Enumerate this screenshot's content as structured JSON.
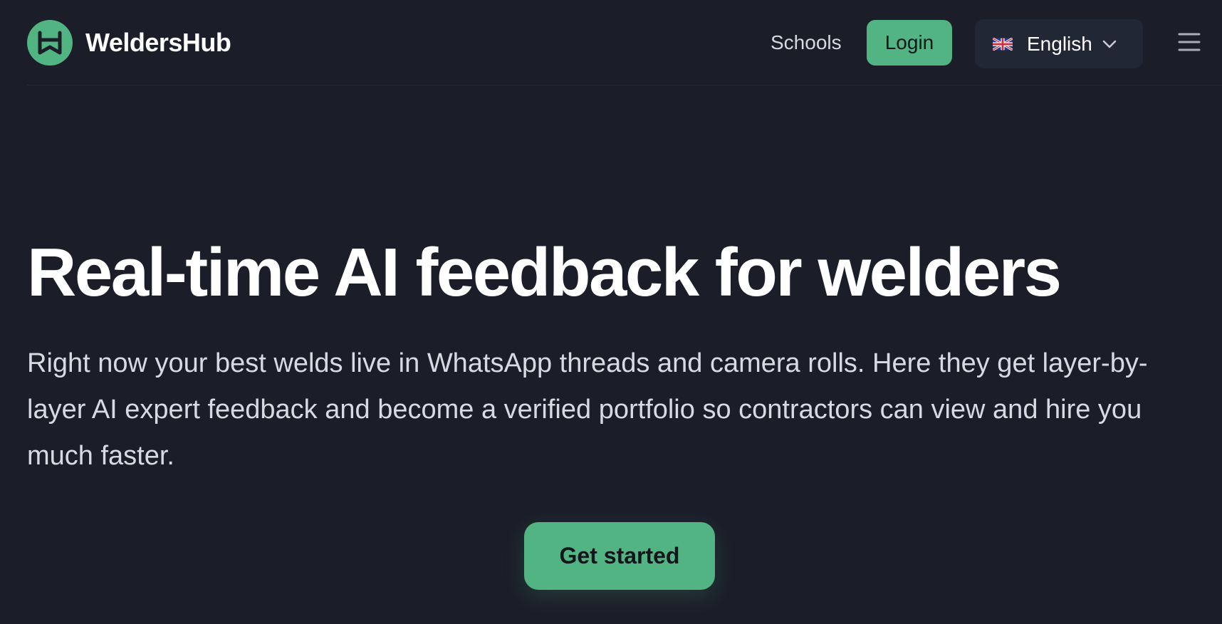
{
  "header": {
    "brand_name": "WeldersHub",
    "nav_schools": "Schools",
    "login_label": "Login",
    "language": {
      "selected": "English",
      "flag": "uk-flag-icon"
    },
    "menu_icon": "hamburger-menu-icon"
  },
  "hero": {
    "title": "Real-time AI feedback for welders",
    "description": "Right now your best welds live in WhatsApp threads and camera rolls. Here they get layer-by-layer AI expert feedback and become a verified portfolio so contractors can view and hire you much faster.",
    "cta_label": "Get started"
  },
  "colors": {
    "background": "#1b1e29",
    "accent": "#52b482",
    "select_background": "#222735",
    "text_muted": "#d7dae3"
  }
}
